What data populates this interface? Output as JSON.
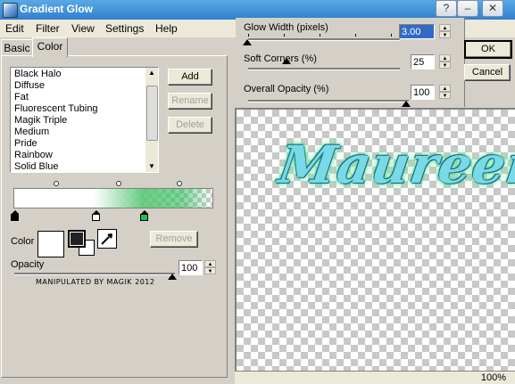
{
  "window": {
    "title": "Gradient Glow"
  },
  "menu": [
    "Edit",
    "Filter",
    "View",
    "Settings",
    "Help"
  ],
  "tabs": {
    "basic": "Basic",
    "color": "Color"
  },
  "presets": {
    "items": [
      "Black Halo",
      "Diffuse",
      "Fat",
      "Fluorescent Tubing",
      "Magik Triple",
      "Medium",
      "Pride",
      "Rainbow",
      "Solid Blue"
    ]
  },
  "preset_buttons": {
    "add": "Add",
    "rename": "Rename",
    "delete": "Delete"
  },
  "gradient": {
    "stops": [
      {
        "position": 0.0,
        "color": "#ffffff"
      },
      {
        "position": 0.42,
        "color": "#ffffff"
      },
      {
        "position": 0.66,
        "color": "#1fbf5a"
      }
    ]
  },
  "color_section": {
    "label": "Color",
    "remove": "Remove"
  },
  "opacity": {
    "label": "Opacity",
    "value": "100"
  },
  "watermark": "MANIPULATED BY MAGIK 2012",
  "settings": {
    "glow_width_label": "Glow Width (pixels)",
    "glow_width_value": "3.00",
    "soft_corners_label": "Soft Corners (%)",
    "soft_corners_value": "25",
    "overall_opacity_label": "Overall Opacity (%)",
    "overall_opacity_value": "100"
  },
  "dialog_buttons": {
    "ok": "OK",
    "cancel": "Cancel"
  },
  "preview": {
    "text": "Maureen"
  },
  "status": {
    "zoom": "100%"
  },
  "colors": {
    "accent": "#1fbf5a",
    "text_fill": "#7ad9e6",
    "outline": "#0f6b84"
  }
}
